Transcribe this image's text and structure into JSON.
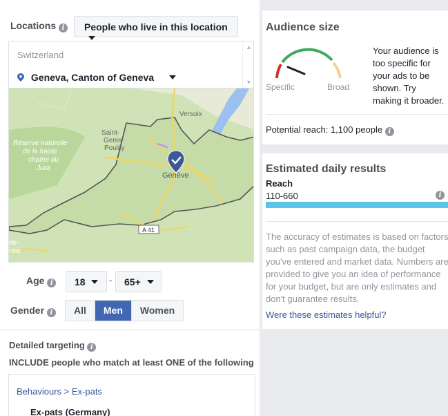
{
  "locations": {
    "label": "Locations",
    "dropdown_value": "People who live in this location",
    "country": "Switzerland",
    "city": "Geneva, Canton of Geneva"
  },
  "map": {
    "labels": [
      "Versoix",
      "Saint-",
      "Genis-",
      "Pouilly",
      "Réserve naturelle",
      "de la haute",
      "chaîne du",
      "Jura",
      "Genève",
      "A 41",
      "de-",
      "rine"
    ]
  },
  "age": {
    "label": "Age",
    "min": "18",
    "dash": "-",
    "max": "65+"
  },
  "gender": {
    "label": "Gender",
    "options": [
      "All",
      "Men",
      "Women"
    ],
    "selected": "Men"
  },
  "detailed_targeting": {
    "label": "Detailed targeting",
    "include_text": "INCLUDE people who match at least ONE of the following",
    "crumb": "Behaviours > Ex-pats",
    "item": "Ex-pats (Germany)"
  },
  "audience": {
    "title": "Audience size",
    "specific_label": "Specific",
    "broad_label": "Broad",
    "description": "Your audience is too specific for your ads to be shown. Try making it broader.",
    "potential_reach": "Potential reach: 1,100 people"
  },
  "estimated": {
    "title": "Estimated daily results",
    "reach_label": "Reach",
    "reach_range": "110-660",
    "reach_fill_fraction": 1.0,
    "note": "The accuracy of estimates is based on factors such as past campaign data, the budget you've entered and market data. Numbers are provided to give you an idea of performance for your budget, but are only estimates and don't guarantee results.",
    "link": "Were these estimates helpful?"
  },
  "colors": {
    "accent": "#4267b2",
    "link": "#365899",
    "reach_bar": "#5bc4e8"
  }
}
